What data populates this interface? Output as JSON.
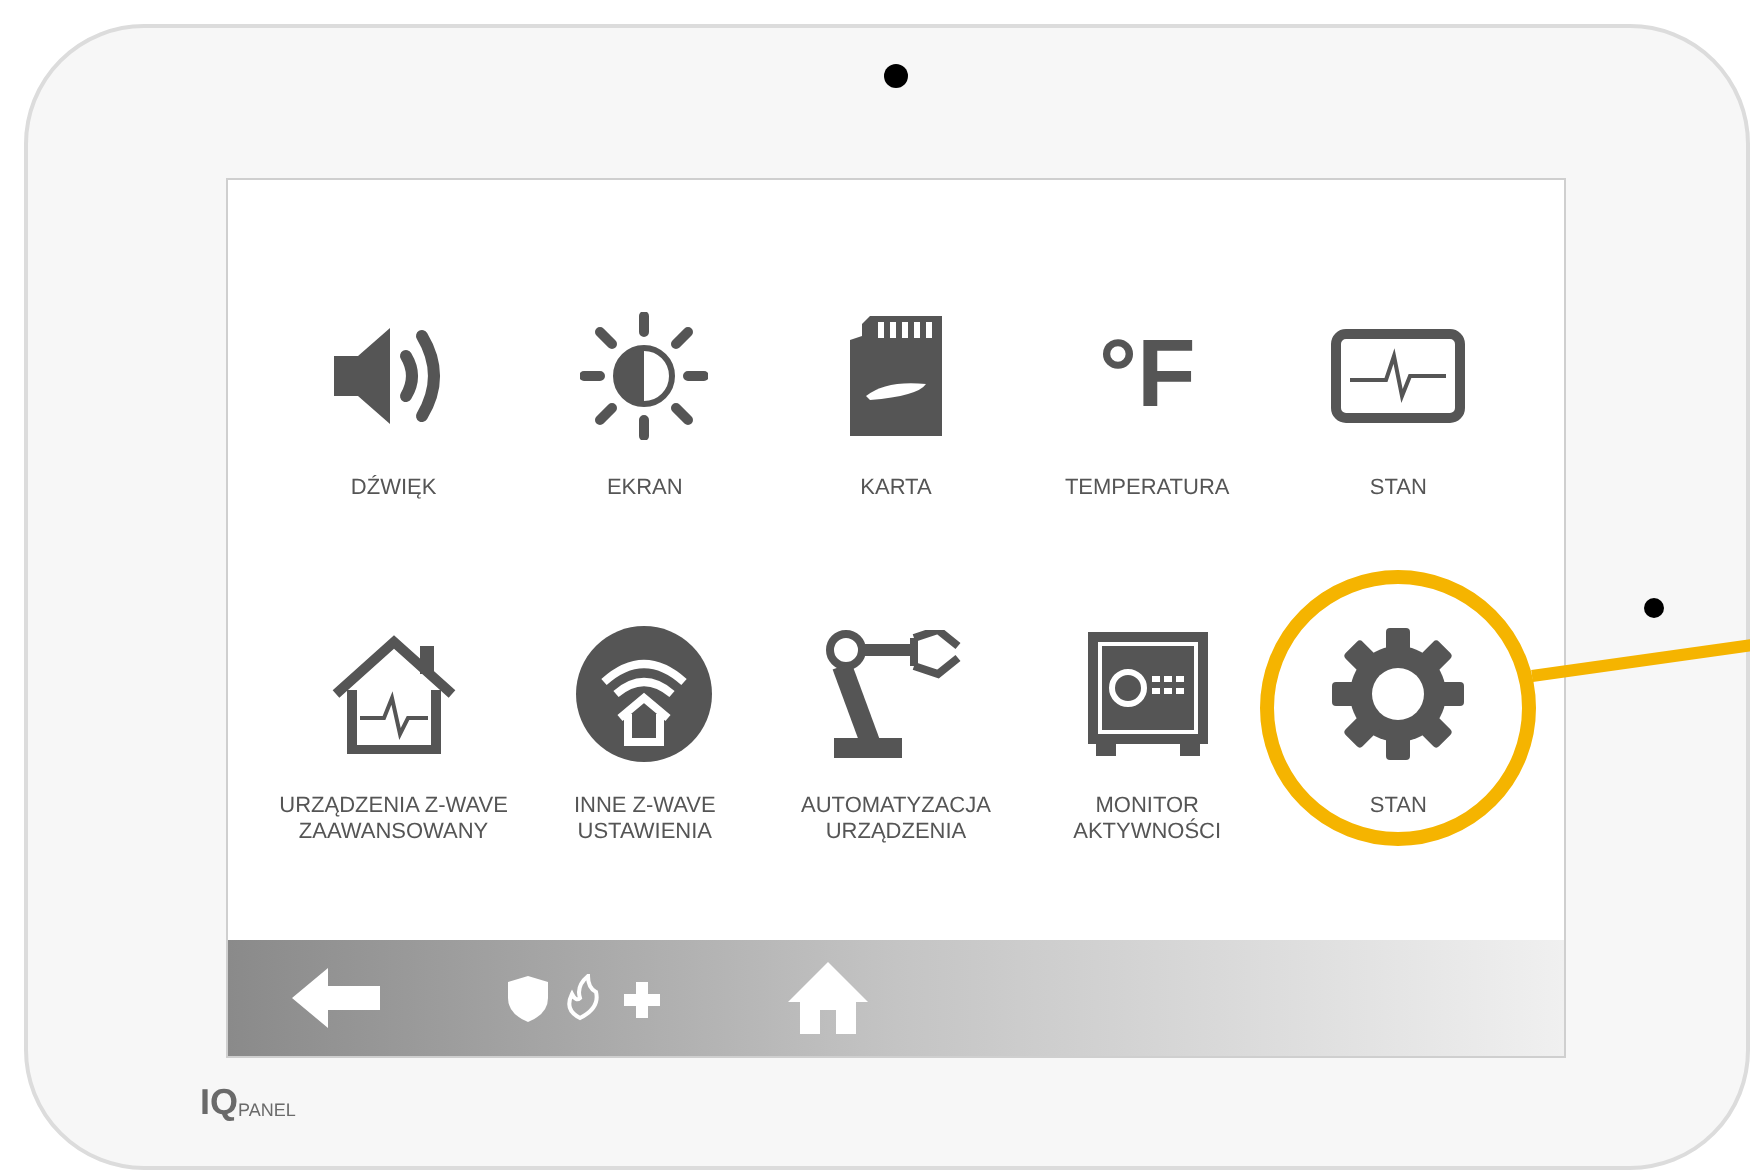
{
  "tiles": [
    {
      "kind": "sound",
      "label": "DŹWIĘK",
      "highlighted": false
    },
    {
      "kind": "brightness",
      "label": "EKRAN",
      "highlighted": false
    },
    {
      "kind": "sdcard",
      "label": "KARTA",
      "highlighted": false
    },
    {
      "kind": "temperature",
      "label": "TEMPERATURA",
      "icon_text": "°F",
      "highlighted": false
    },
    {
      "kind": "status",
      "label": "STAN",
      "highlighted": false
    },
    {
      "kind": "house",
      "label": "URZĄDZENIA Z-WAVE ZAAWANSOWANY",
      "highlighted": false
    },
    {
      "kind": "wifi-house",
      "label": "INNE Z-WAVE USTAWIENIA",
      "highlighted": false
    },
    {
      "kind": "robot",
      "label": "AUTOMATYZACJA URZĄDZENIA",
      "highlighted": false
    },
    {
      "kind": "safe",
      "label": "MONITOR AKTYWNOŚCI",
      "highlighted": false
    },
    {
      "kind": "gear",
      "label": "STAN",
      "highlighted": true
    }
  ],
  "bottom_bar": [
    {
      "kind": "back"
    },
    {
      "kind": "emergency"
    },
    {
      "kind": "home"
    }
  ],
  "brand": {
    "mark": "IQ",
    "name": "PANEL"
  }
}
